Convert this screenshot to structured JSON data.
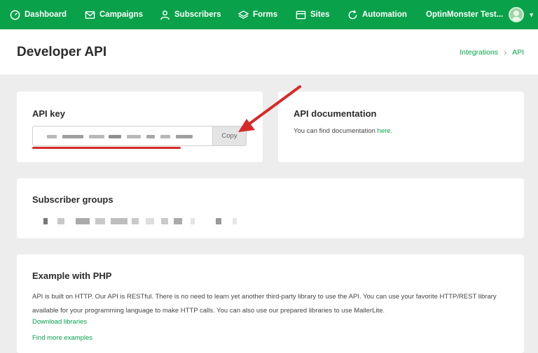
{
  "nav": {
    "items": [
      {
        "label": "Dashboard",
        "icon": "dashboard-icon"
      },
      {
        "label": "Campaigns",
        "icon": "envelope-icon"
      },
      {
        "label": "Subscribers",
        "icon": "user-icon"
      },
      {
        "label": "Forms",
        "icon": "layers-icon"
      },
      {
        "label": "Sites",
        "icon": "browser-icon"
      },
      {
        "label": "Automation",
        "icon": "refresh-icon"
      }
    ],
    "account_name": "OptinMonster Test...",
    "caret": "▾"
  },
  "header": {
    "title": "Developer API",
    "breadcrumb": [
      "Integrations",
      "API"
    ],
    "separator": "›"
  },
  "api_key_card": {
    "title": "API key",
    "copy_label": "Copy"
  },
  "api_doc_card": {
    "title": "API documentation",
    "text": "You can find documentation ",
    "link": "here."
  },
  "subscriber_groups_card": {
    "title": "Subscriber groups"
  },
  "php_card": {
    "title": "Example with PHP",
    "text": "API is built on HTTP. Our API is RESTful. There is no need to learn yet another third-party library to use the API. You can use your favorite HTTP/REST library available for your programming language to make HTTP calls. You can also use our prepared libraries to use MailerLite.",
    "links": [
      "Download libraries",
      "Find more examples"
    ]
  },
  "colors": {
    "brand_green": "#09a24a",
    "annotation_red": "#d62a2a"
  }
}
